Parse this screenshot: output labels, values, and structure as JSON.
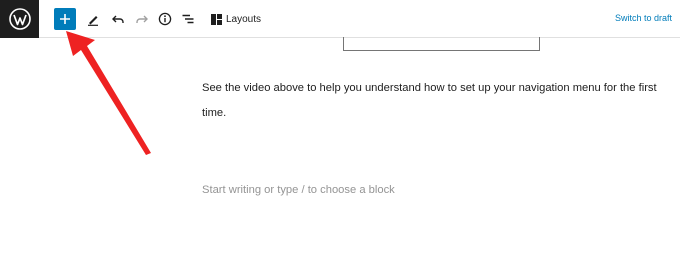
{
  "toolbar": {
    "layouts_label": "Layouts",
    "switch_to_draft_label": "Switch to draft",
    "icons": [
      "wordpress-icon",
      "plus-icon",
      "pencil-icon",
      "undo-icon",
      "redo-icon",
      "info-icon",
      "list-view-icon",
      "layouts-icon"
    ]
  },
  "content": {
    "paragraph": "See the video above to help you understand how to set up your navigation menu for the first time.",
    "block_placeholder": "Start writing or type / to choose a block"
  },
  "colors": {
    "accent": "#007cba",
    "logo_bg": "#1e1e1e",
    "annotation_arrow": "#ee2222"
  }
}
